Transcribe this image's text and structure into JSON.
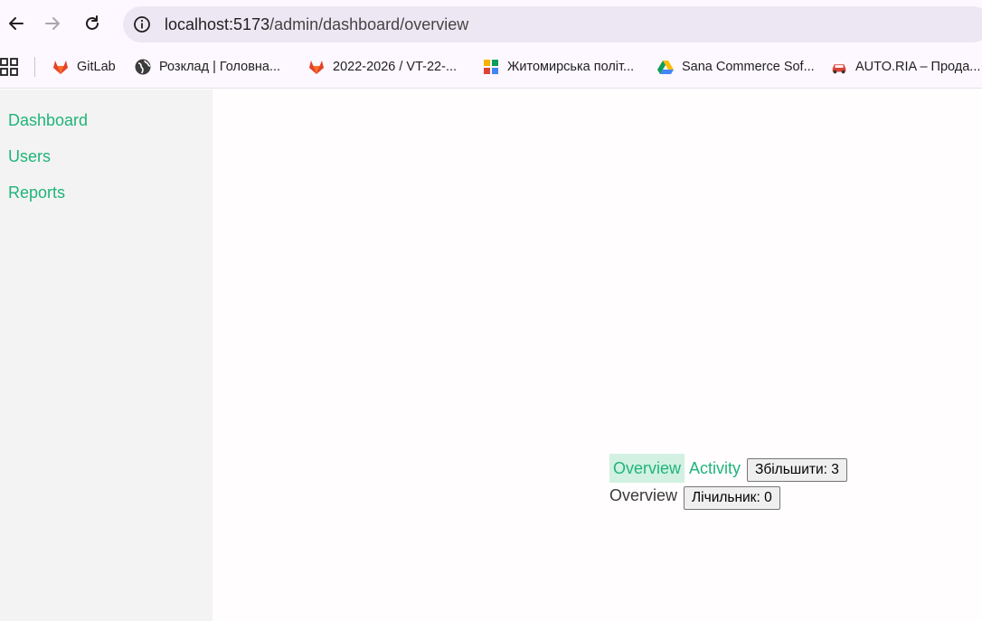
{
  "browser": {
    "url_host": "localhost:5173",
    "url_path": "/admin/dashboard/overview",
    "bookmarks": [
      {
        "label": "GitLab",
        "icon": "gitlab-icon"
      },
      {
        "label": "Розклад | Головна...",
        "icon": "globe-icon"
      },
      {
        "label": "2022-2026 / VT-22-...",
        "icon": "gitlab-icon"
      },
      {
        "label": "Житомирська політ...",
        "icon": "university-icon"
      },
      {
        "label": "Sana Commerce Sof...",
        "icon": "drive-icon"
      },
      {
        "label": "AUTO.RIA – Прода...",
        "icon": "car-icon"
      }
    ]
  },
  "sidebar": {
    "items": [
      {
        "label": "Dashboard"
      },
      {
        "label": "Users"
      },
      {
        "label": "Reports"
      }
    ]
  },
  "main": {
    "tabs": [
      {
        "label": "Overview",
        "active": true
      },
      {
        "label": "Activity",
        "active": false
      }
    ],
    "increase_button": "Збільшити: 3",
    "overview_label": "Overview",
    "counter_button": "Лічильник: 0"
  },
  "colors": {
    "link": "#1fb47a",
    "active_tab_bg": "#d2f1e3",
    "sidebar_bg": "#f3f3f3"
  }
}
